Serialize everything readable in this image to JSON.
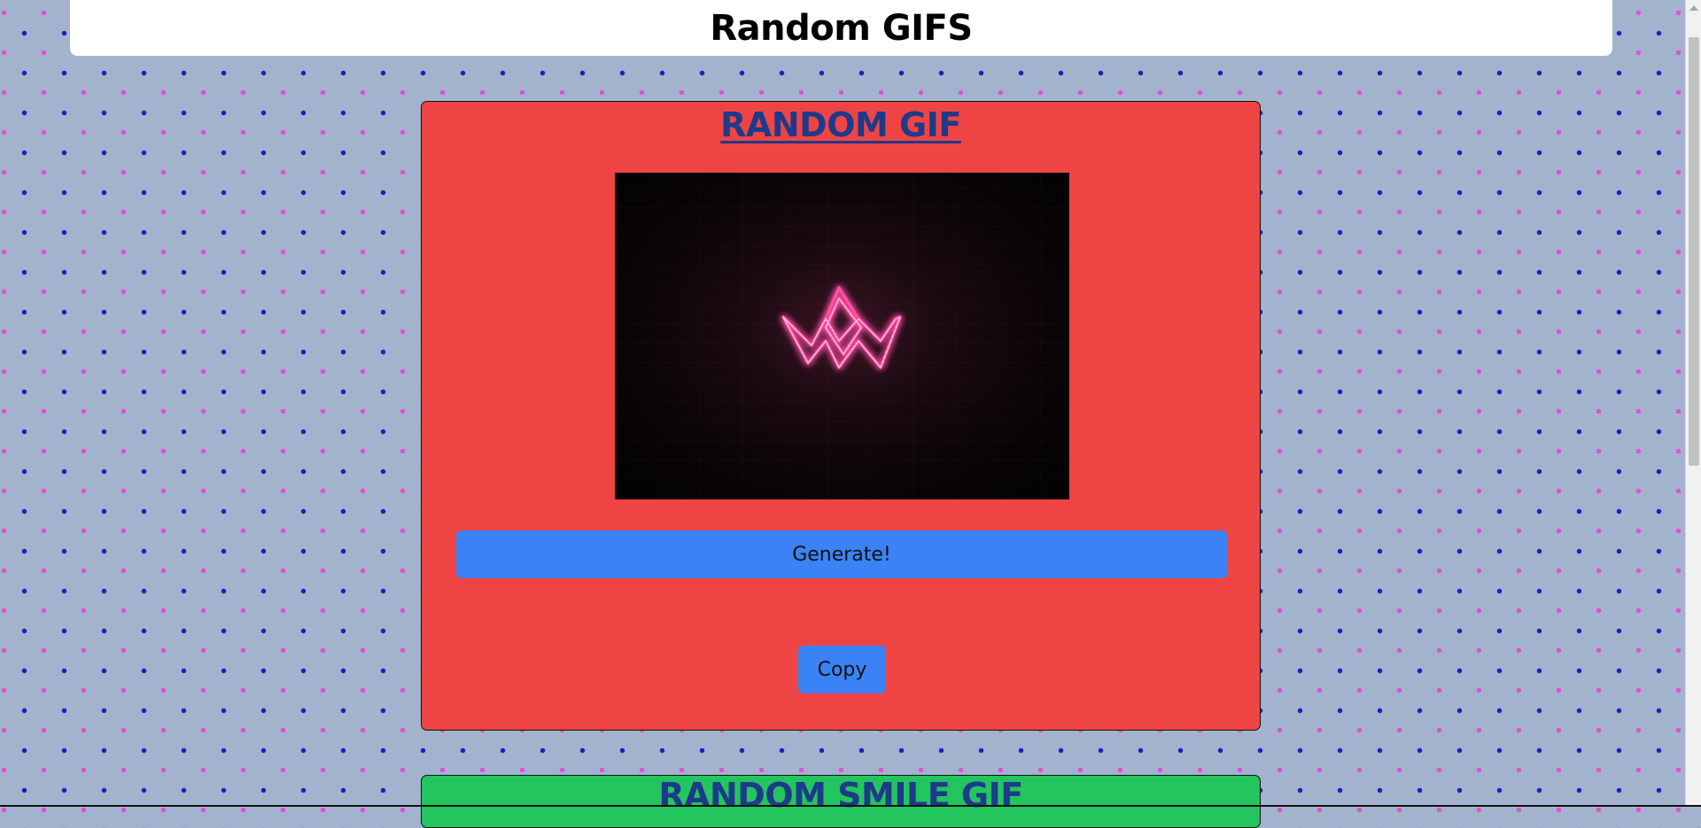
{
  "header": {
    "title": "Random GIFS"
  },
  "random_gif_card": {
    "title": "RANDOM GIF",
    "image_alt": "Neon pink crown on dark brick wall",
    "generate_label": "Generate!",
    "copy_label": "Copy"
  },
  "random_smile_card": {
    "title": "RANDOM SMILE GIF"
  },
  "colors": {
    "background": "#a3b3cd",
    "dot_primary": "#1a1fbf",
    "dot_secondary": "#e14fd0",
    "red_card": "#ef4444",
    "green_card": "#22c55e",
    "button": "#3b82f6",
    "title_text": "#1e3a8a",
    "neon": "#ff4fa3"
  }
}
